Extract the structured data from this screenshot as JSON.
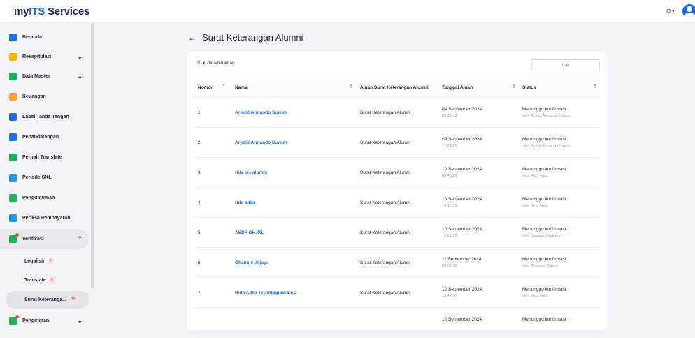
{
  "app": {
    "logo_my": "my",
    "logo_its": "ITS",
    "logo_rest": " Services",
    "lang": "ID ▾"
  },
  "sidebar": {
    "items": [
      {
        "label": "Beranda",
        "icon": "home-icon",
        "color": "#1e6fe0"
      },
      {
        "label": "Rekapitulasi",
        "icon": "chart-icon",
        "color": "#f5b800",
        "chevron": "⌄"
      },
      {
        "label": "Data Master",
        "icon": "database-icon",
        "color": "#18b45a",
        "chevron": "⌄"
      },
      {
        "label": "Keuangan",
        "icon": "wallet-icon",
        "color": "#f5a623"
      },
      {
        "label": "Label Tanda Tangan",
        "icon": "pen-icon",
        "color": "#1e6fe0"
      },
      {
        "label": "Penandatangan",
        "icon": "signer-icon",
        "color": "#1e6fe0"
      },
      {
        "label": "Pernah Translate",
        "icon": "translate-icon",
        "color": "#18b45a"
      },
      {
        "label": "Periode SKL",
        "icon": "calendar-icon",
        "color": "#1e9be0"
      },
      {
        "label": "Pengumuman",
        "icon": "megaphone-icon",
        "color": "#18b45a"
      },
      {
        "label": "Periksa Pembayaran",
        "icon": "payment-icon",
        "color": "#1e9be0"
      },
      {
        "label": "Verifikasi",
        "icon": "verify-icon",
        "color": "#18b45a",
        "chevron": "⌃"
      }
    ],
    "subitems": [
      {
        "label": "Legalisir",
        "count": "7"
      },
      {
        "label": "Translate",
        "count": "6"
      },
      {
        "label": "Surat Keteranga...",
        "count": "30"
      }
    ],
    "last_item": {
      "label": "Pengiriman",
      "chevron": "⌄"
    }
  },
  "page": {
    "title": "Surat Keterangan Alumni",
    "back": "←"
  },
  "table": {
    "page_size": "10 ▾",
    "page_size_label": "data/halaman",
    "search_placeholder": "Cari",
    "headers": [
      "Nomor",
      "Nama",
      "Ajuan Surat Keterangan Alumni",
      "Tanggal Ajuan",
      "Status"
    ],
    "rows": [
      {
        "no": "1",
        "nama": "Arnold Armando Suwuh",
        "ajuan": "Surat Keterangan Alumni",
        "date": "04 September 2024",
        "time": "09:31:43",
        "status": "Menunggu konfirmasi",
        "by": "oleh Arnold Armando Suwuh"
      },
      {
        "no": "2",
        "nama": "Arnold Armando Suwuh",
        "ajuan": "Surat Keterangan Alumni",
        "date": "09 September 2024",
        "time": "12:21:28",
        "status": "Menunggu konfirmasi",
        "by": "oleh Arnold Armando Suwuh"
      },
      {
        "no": "3",
        "nama": "rida tes alumni",
        "ajuan": "Surat Keterangan Alumni",
        "date": "10 September 2024",
        "time": "09:40:29",
        "status": "Menunggu konfirmasi",
        "by": "oleh Rida Adila"
      },
      {
        "no": "4",
        "nama": "rida adila",
        "ajuan": "Surat Keterangan Alumni",
        "date": "10 September 2024",
        "time": "14:15:25",
        "status": "Menunggu konfirmasi",
        "by": "oleh Rida Adila"
      },
      {
        "no": "5",
        "nama": "ASDF GHJKL",
        "ajuan": "Surat Keterangan Alumni",
        "date": "10 September 2024",
        "time": "15:58:18",
        "status": "Menunggu konfirmasi",
        "by": "oleh Yasnaul Khakima"
      },
      {
        "no": "6",
        "nama": "Ghannie Wijaya",
        "ajuan": "Surat Keterangan Alumni",
        "date": "11 September 2024",
        "time": "08:07:28",
        "status": "Menunggu konfirmasi",
        "by": "oleh Ghannie Wijaya"
      },
      {
        "no": "7",
        "nama": "Rida Adila Tes Integrasi SSO",
        "ajuan": "Surat Keterangan Alumni",
        "date": "12 September 2024",
        "time": "13:47:16",
        "status": "Menunggu konfirmasi",
        "by": "oleh Rida Adila"
      },
      {
        "no": "",
        "nama": "",
        "ajuan": "",
        "date": "12 September 2024",
        "time": "",
        "status": "Menunggu konfirmasi",
        "by": ""
      }
    ]
  }
}
